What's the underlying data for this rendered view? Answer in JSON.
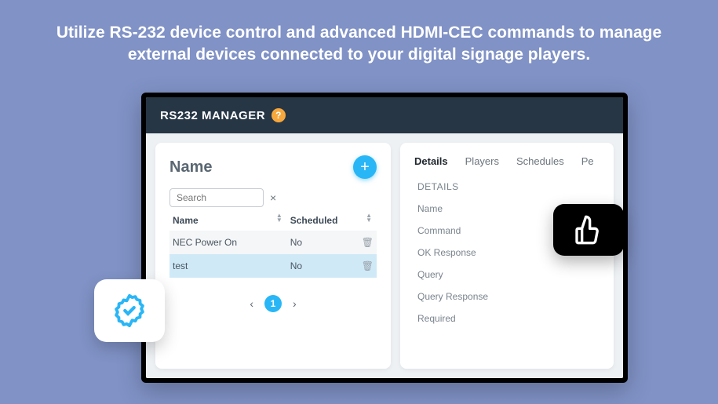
{
  "headline": "Utilize RS-232 device control and advanced HDMI-CEC commands to manage external devices connected to your digital signage players.",
  "titlebar": {
    "label": "RS232 MANAGER",
    "help": "?"
  },
  "left": {
    "title": "Name",
    "add": "+",
    "search_placeholder": "Search",
    "clear": "×",
    "col_name": "Name",
    "col_scheduled": "Scheduled",
    "rows": [
      {
        "name": "NEC Power On",
        "scheduled": "No"
      },
      {
        "name": "test",
        "scheduled": "No"
      }
    ],
    "page": "1",
    "prev": "‹",
    "next": "›"
  },
  "right": {
    "tabs": [
      "Details",
      "Players",
      "Schedules",
      "Pe"
    ],
    "section": "DETAILS",
    "fields": [
      "Name",
      "Command",
      "OK Response",
      "Query",
      "Query Response",
      "Required"
    ]
  }
}
